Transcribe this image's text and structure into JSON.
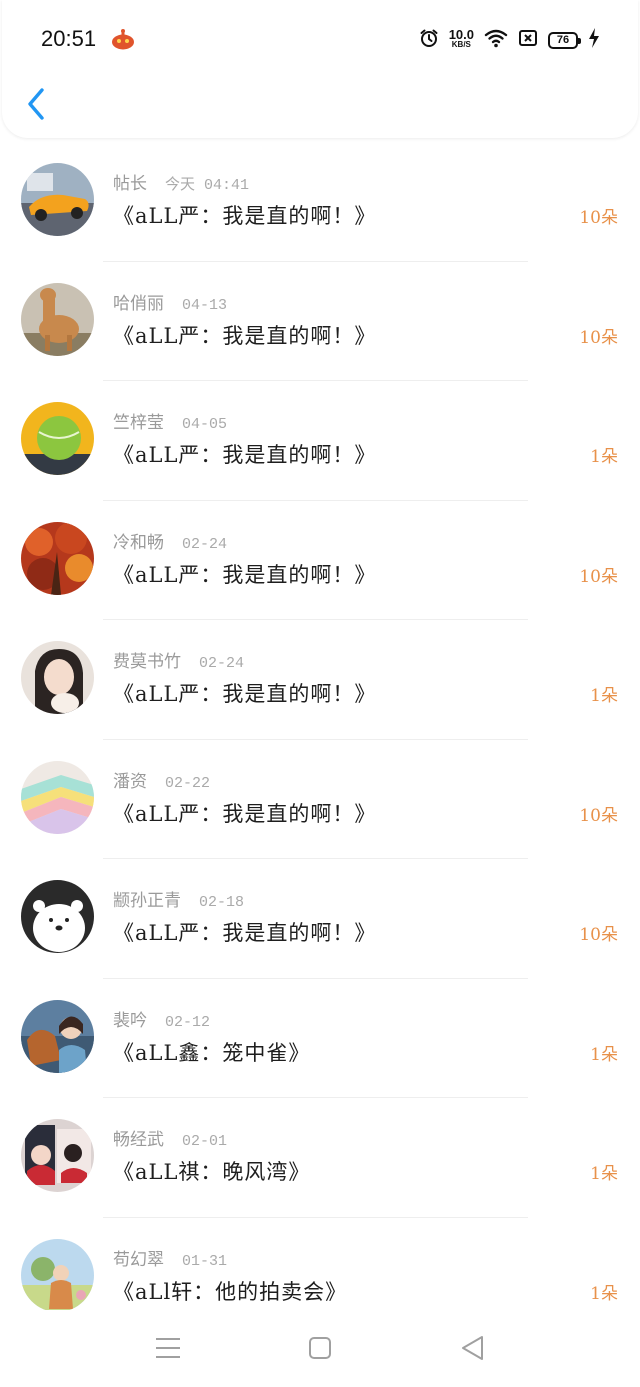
{
  "status_bar": {
    "time": "20:51",
    "net_speed_value": "10.0",
    "net_speed_unit": "KB/S",
    "battery": "76"
  },
  "icons": {
    "back": "chevron-left-icon",
    "alarm": "alarm-icon",
    "wifi": "wifi-icon",
    "nfc": "nfc-icon",
    "charging": "bolt-icon"
  },
  "colors": {
    "accent": "#2196F3",
    "flowers": "#e8914a",
    "meta": "#9a9a9a"
  },
  "items": [
    {
      "name": "帖长",
      "date": "今天 04:41",
      "message": "《aLL严：我是直的啊！》",
      "flowers": "10朵"
    },
    {
      "name": "哈俏丽",
      "date": "04-13",
      "message": "《aLL严：我是直的啊！》",
      "flowers": "10朵"
    },
    {
      "name": "竺梓莹",
      "date": "04-05",
      "message": "《aLL严：我是直的啊！》",
      "flowers": "1朵"
    },
    {
      "name": "冷和畅",
      "date": "02-24",
      "message": "《aLL严：我是直的啊！》",
      "flowers": "10朵"
    },
    {
      "name": "费莫书竹",
      "date": "02-24",
      "message": "《aLL严：我是直的啊！》",
      "flowers": "1朵"
    },
    {
      "name": "潘资",
      "date": "02-22",
      "message": "《aLL严：我是直的啊！》",
      "flowers": "10朵"
    },
    {
      "name": "颛孙正青",
      "date": "02-18",
      "message": "《aLL严：我是直的啊！》",
      "flowers": "10朵"
    },
    {
      "name": "裴吟",
      "date": "02-12",
      "message": "《aLL鑫：笼中雀》",
      "flowers": "1朵"
    },
    {
      "name": "畅经武",
      "date": "02-01",
      "message": "《aLL祺：晚风湾》",
      "flowers": "1朵"
    },
    {
      "name": "苟幻翠",
      "date": "01-31",
      "message": "《aLl轩：他的拍卖会》",
      "flowers": "1朵"
    }
  ]
}
